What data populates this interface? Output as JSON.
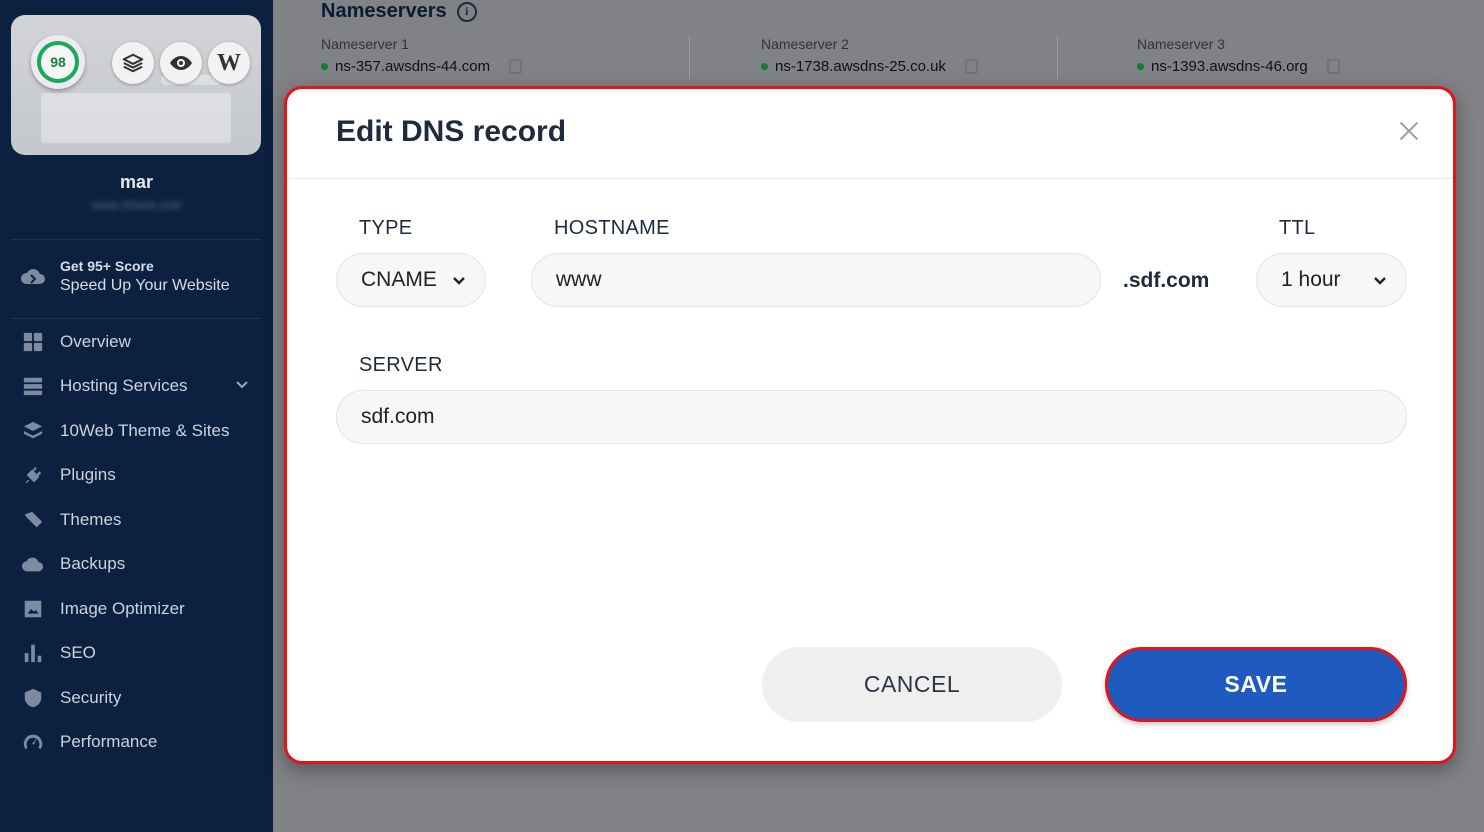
{
  "sidebar": {
    "score": "98",
    "site_name": "mar",
    "site_url": "www.10web.club",
    "thumb_buttons": [
      "layers-icon",
      "eye-icon",
      "wordpress-icon"
    ],
    "promo": {
      "title": "Get 95+ Score",
      "subtitle": "Speed Up Your Website"
    },
    "items": [
      {
        "label": "Overview",
        "icon": "grid-icon"
      },
      {
        "label": "Hosting Services",
        "icon": "server-icon",
        "has_submenu": true
      },
      {
        "label": "10Web Theme & Sites",
        "icon": "layers-icon"
      },
      {
        "label": "Plugins",
        "icon": "plug-icon"
      },
      {
        "label": "Themes",
        "icon": "brush-icon"
      },
      {
        "label": "Backups",
        "icon": "cloud-backup-icon"
      },
      {
        "label": "Image Optimizer",
        "icon": "image-icon"
      },
      {
        "label": "SEO",
        "icon": "bar-chart-icon"
      },
      {
        "label": "Security",
        "icon": "shield-icon"
      },
      {
        "label": "Performance",
        "icon": "gauge-icon"
      }
    ]
  },
  "background": {
    "section_title": "Nameservers",
    "nameservers": [
      {
        "label": "Nameserver 1",
        "value": "ns-357.awsdns-44.com"
      },
      {
        "label": "Nameserver 2",
        "value": "ns-1738.awsdns-25.co.uk"
      },
      {
        "label": "Nameserver 3",
        "value": "ns-1393.awsdns-46.org"
      }
    ],
    "status_color": "#157a2c"
  },
  "modal": {
    "title": "Edit DNS record",
    "type": {
      "label": "TYPE",
      "value": "CNAME"
    },
    "hostname": {
      "label": "HOSTNAME",
      "value": "www",
      "suffix": ".sdf.com"
    },
    "ttl": {
      "label": "TTL",
      "value": "1 hour"
    },
    "server": {
      "label": "SERVER",
      "value": "sdf.com"
    },
    "cancel_label": "CANCEL",
    "save_label": "SAVE",
    "accent_color": "#1f5bbf",
    "highlight_color": "#e3141b"
  }
}
